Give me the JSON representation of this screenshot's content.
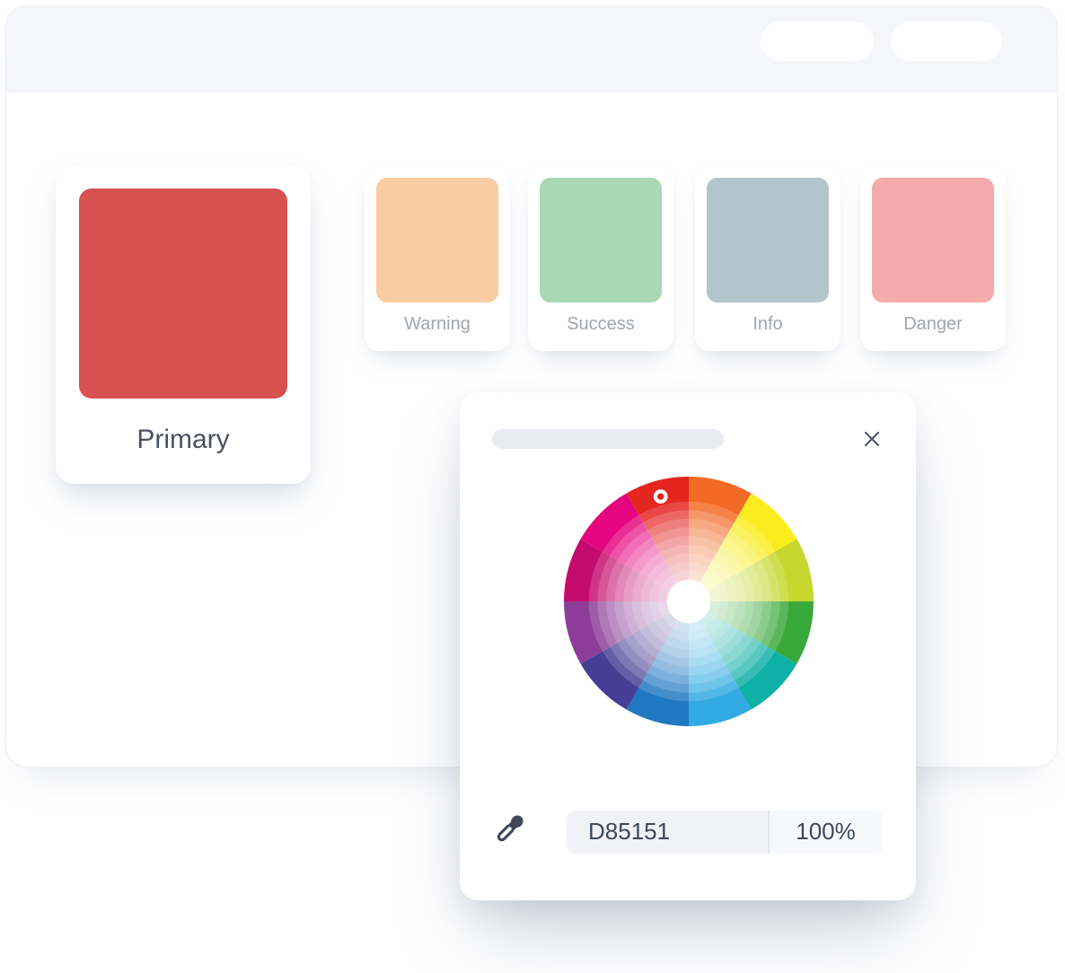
{
  "window": {
    "header": {
      "buttons": [
        {
          "name": "header-pill-1",
          "label": ""
        },
        {
          "name": "header-pill-2",
          "label": ""
        }
      ]
    }
  },
  "palette": {
    "primary": {
      "label": "Primary",
      "color": "#D85151"
    },
    "swatches": [
      {
        "label": "Warning",
        "color": "#FACCA3"
      },
      {
        "label": "Success",
        "color": "#A9D8B5"
      },
      {
        "label": "Info",
        "color": "#B1C5CA"
      },
      {
        "label": "Danger",
        "color": "#F5ABAB"
      }
    ]
  },
  "picker": {
    "title_placeholder": "",
    "hex_value": "D85151",
    "opacity_value": "100%",
    "selected_color": "#E42520",
    "icons": {
      "close": "close-icon",
      "eyedropper": "eyedropper-icon"
    },
    "colors": {
      "icon": "#4E5566",
      "field_bg": "#F0F2F6",
      "field_bg_light": "#F6F8FB"
    },
    "wheel": {
      "segment_colors_clockwise_from_top": [
        "#F26A25",
        "#FAED1E",
        "#C6D72D",
        "#39A93C",
        "#0FB0A6",
        "#30AAE1",
        "#1F78C2",
        "#463D95",
        "#8C3D98",
        "#C60B6E",
        "#E5047F",
        "#E42520"
      ],
      "ring_fractions": [
        0.8,
        0.731,
        0.662,
        0.593,
        0.524,
        0.455,
        0.386,
        0.317,
        0.248
      ],
      "ring_step_opacity": 0.17,
      "center_fraction": 0.175,
      "marker": {
        "angle_deg": -105,
        "radius_fraction": 0.87
      }
    }
  }
}
